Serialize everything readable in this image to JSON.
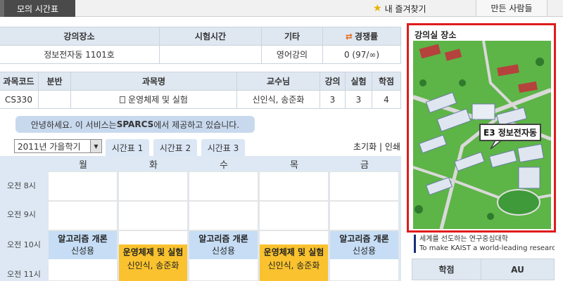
{
  "topbar": {
    "tab_label": "모의 시간표",
    "favorites_label": "내 즐겨찾기",
    "makers_label": "만든 사람들",
    "favorites_icon": "star-icon",
    "star_color": "#e8b400"
  },
  "course_info": {
    "headers": [
      "강의장소",
      "시험시간",
      "기타",
      "경쟁률"
    ],
    "row": [
      "정보전자동 1101호",
      "",
      "영어강의",
      "0 (97/∞)"
    ]
  },
  "course_table": {
    "headers": [
      "과목코드",
      "분반",
      "과목명",
      "교수님",
      "강의",
      "실험",
      "학점"
    ],
    "row": [
      "CS330",
      "",
      "운영체제 및 실험",
      "신인식, 송준화",
      "3",
      "3",
      "4"
    ]
  },
  "notice": {
    "prefix": "안녕하세요. 이 서비스는 ",
    "brand": "SPARCS",
    "suffix": "에서 제공하고 있습니다."
  },
  "semester_select": {
    "value": "2011년 가을학기"
  },
  "timetable_tabs": [
    "시간표 1",
    "시간표 2",
    "시간표 3"
  ],
  "links": {
    "reset": "초기화",
    "separator": "|",
    "print": "인쇄"
  },
  "timetable": {
    "days": [
      "월",
      "화",
      "수",
      "목",
      "금"
    ],
    "times": [
      "오전 8시",
      "오전 9시",
      "오전 10시",
      "오전 11시"
    ],
    "courses": [
      {
        "name": "알고리즘 개론",
        "prof": "신성용",
        "color": "#c6ddf5"
      },
      {
        "name": "운영체제 및 실험",
        "prof": "신인식, 송준화",
        "color": "#f9c22e"
      }
    ]
  },
  "right_panel": {
    "map_title": "강의실 장소",
    "map_label": "E3 정보전자동",
    "highlight_color": "#e01b1b",
    "banner_line1": "세계를 선도하는 연구중심대학",
    "banner_line2": "To make KAIST a world-leading research-o",
    "au_headers": [
      "학점",
      "AU"
    ]
  }
}
